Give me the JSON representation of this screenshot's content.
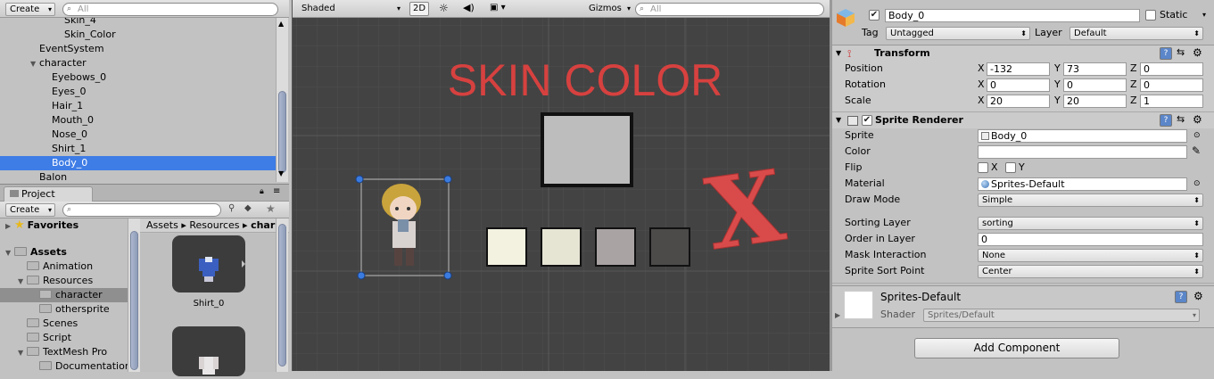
{
  "hierarchy": {
    "create_label": "Create",
    "search_placeholder": "All",
    "items": [
      {
        "label": "Skin_4",
        "indent": 4,
        "arrow": "",
        "selected": false
      },
      {
        "label": "Skin_Color",
        "indent": 4,
        "arrow": "",
        "selected": false
      },
      {
        "label": "EventSystem",
        "indent": 2,
        "arrow": "",
        "selected": false
      },
      {
        "label": "character",
        "indent": 2,
        "arrow": "▼",
        "selected": false
      },
      {
        "label": "Eyebows_0",
        "indent": 3,
        "arrow": "",
        "selected": false
      },
      {
        "label": "Eyes_0",
        "indent": 3,
        "arrow": "",
        "selected": false
      },
      {
        "label": "Hair_1",
        "indent": 3,
        "arrow": "",
        "selected": false
      },
      {
        "label": "Mouth_0",
        "indent": 3,
        "arrow": "",
        "selected": false
      },
      {
        "label": "Nose_0",
        "indent": 3,
        "arrow": "",
        "selected": false
      },
      {
        "label": "Shirt_1",
        "indent": 3,
        "arrow": "",
        "selected": false
      },
      {
        "label": "Body_0",
        "indent": 3,
        "arrow": "",
        "selected": true
      },
      {
        "label": "Balon",
        "indent": 2,
        "arrow": "",
        "selected": false
      }
    ]
  },
  "project": {
    "tab_label": "Project",
    "create_label": "Create",
    "tree": [
      {
        "label": "Favorites",
        "indent": 0,
        "arrow": "▶",
        "bold": true,
        "icon": "star-icon",
        "selected": false
      },
      {
        "label": "Assets",
        "indent": 0,
        "arrow": "▼",
        "bold": true,
        "icon": "folder-icon",
        "selected": false
      },
      {
        "label": "Animation",
        "indent": 1,
        "arrow": "",
        "bold": false,
        "icon": "folder-icon",
        "selected": false
      },
      {
        "label": "Resources",
        "indent": 1,
        "arrow": "▼",
        "bold": false,
        "icon": "folder-icon",
        "selected": false
      },
      {
        "label": "character",
        "indent": 2,
        "arrow": "",
        "bold": false,
        "icon": "folder-icon",
        "selected": true
      },
      {
        "label": "othersprite",
        "indent": 2,
        "arrow": "",
        "bold": false,
        "icon": "folder-icon",
        "selected": false
      },
      {
        "label": "Scenes",
        "indent": 1,
        "arrow": "",
        "bold": false,
        "icon": "folder-icon",
        "selected": false
      },
      {
        "label": "Script",
        "indent": 1,
        "arrow": "",
        "bold": false,
        "icon": "folder-icon",
        "selected": false
      },
      {
        "label": "TextMesh Pro",
        "indent": 1,
        "arrow": "▼",
        "bold": false,
        "icon": "folder-icon",
        "selected": false
      },
      {
        "label": "Documentation",
        "indent": 2,
        "arrow": "",
        "bold": false,
        "icon": "folder-icon",
        "selected": false
      }
    ],
    "breadcrumb": [
      "Assets",
      "Resources",
      "char"
    ],
    "assets": [
      {
        "label": "Shirt_0"
      },
      {
        "label": ""
      }
    ]
  },
  "scene": {
    "shading_mode": "Shaded",
    "mode_2d": "2D",
    "gizmos_label": "Gizmos",
    "search_placeholder": "All",
    "title_text": "SKIN COLOR",
    "close_mark": "X",
    "swatch_colors": [
      "#f3f1e0",
      "#e6e4d3",
      "#a9a3a4",
      "#4d4a4a"
    ],
    "preview_color": "#bdbdbd"
  },
  "inspector": {
    "object_name": "Body_0",
    "static_label": "Static",
    "tag_label": "Tag",
    "tag_value": "Untagged",
    "layer_label": "Layer",
    "layer_value": "Default",
    "transform": {
      "title": "Transform",
      "rows": [
        {
          "label": "Position",
          "x": "-132",
          "y": "73",
          "z": "0"
        },
        {
          "label": "Rotation",
          "x": "0",
          "y": "0",
          "z": "0"
        },
        {
          "label": "Scale",
          "x": "20",
          "y": "20",
          "z": "1"
        }
      ]
    },
    "sprite_renderer": {
      "title": "Sprite Renderer",
      "sprite_label": "Sprite",
      "sprite_value": "Body_0",
      "color_label": "Color",
      "flip_label": "Flip",
      "flip_x": "X",
      "flip_y": "Y",
      "material_label": "Material",
      "material_value": "Sprites-Default",
      "draw_mode_label": "Draw Mode",
      "draw_mode_value": "Simple",
      "sorting_layer_label": "Sorting Layer",
      "sorting_layer_value": "sorting",
      "order_label": "Order in Layer",
      "order_value": "0",
      "mask_label": "Mask Interaction",
      "mask_value": "None",
      "sort_point_label": "Sprite Sort Point",
      "sort_point_value": "Center"
    },
    "material": {
      "name": "Sprites-Default",
      "shader_label": "Shader",
      "shader_value": "Sprites/Default"
    },
    "add_component_label": "Add Component",
    "colors": {
      "accent": "#3e7ce6",
      "title_red": "#d6413f"
    }
  }
}
